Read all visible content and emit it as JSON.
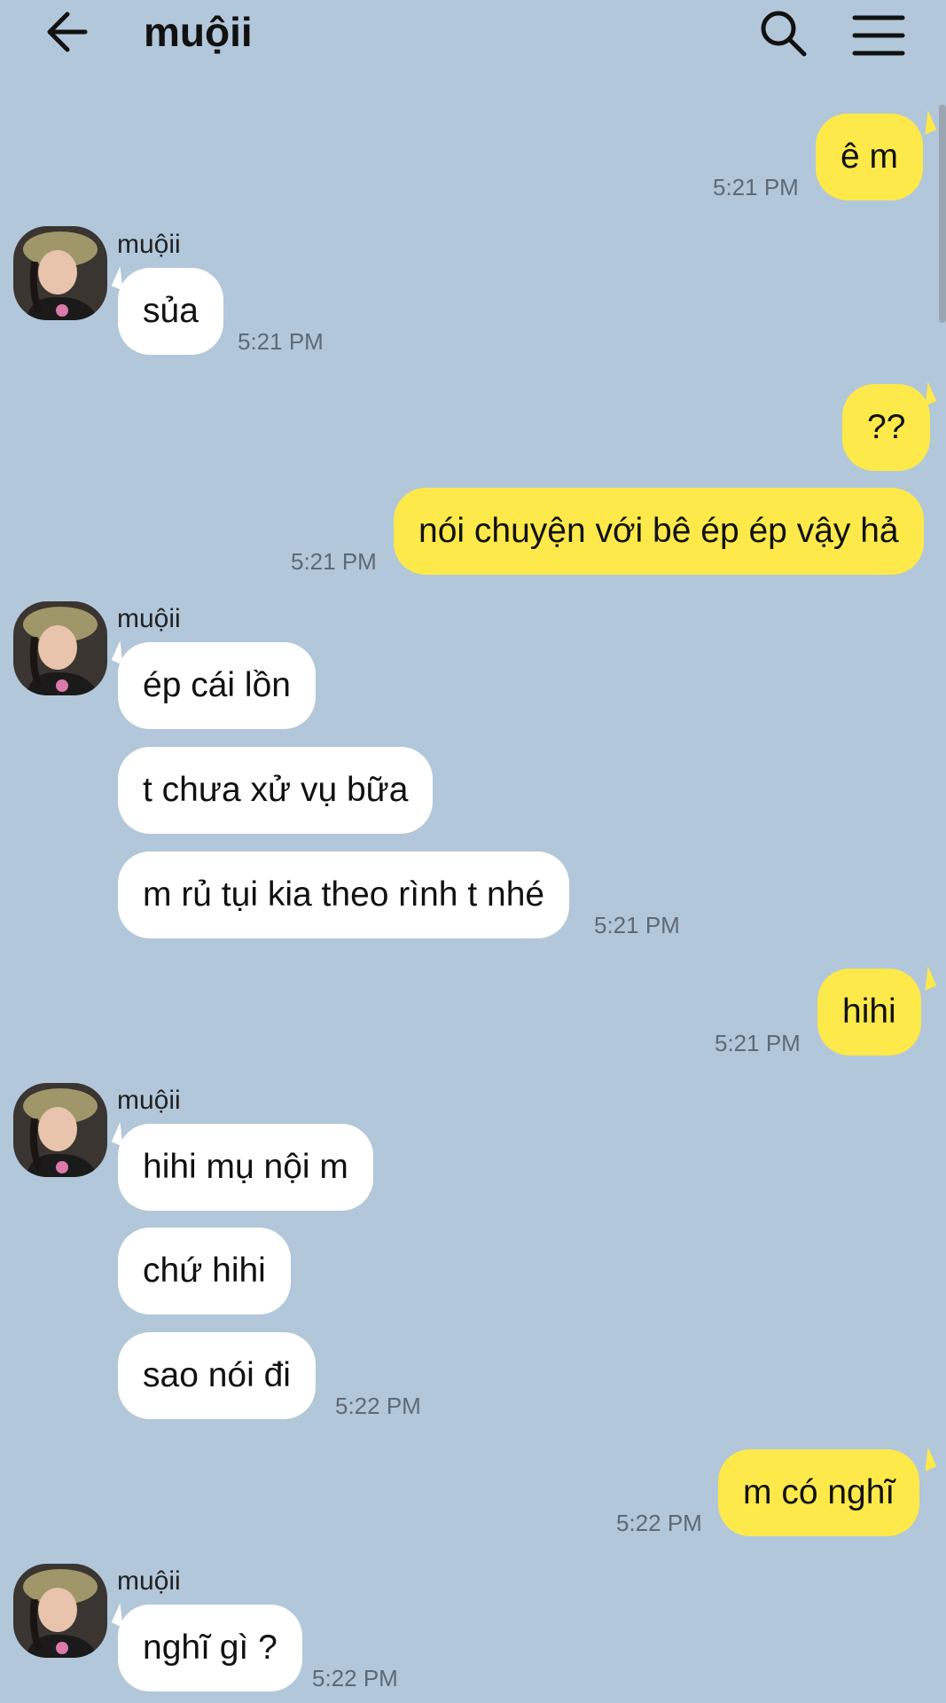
{
  "header": {
    "title": "muộii"
  },
  "messages": [
    {
      "from": "me",
      "text": "ê m",
      "time": "5:21 PM"
    },
    {
      "from": "them",
      "sender": "muộii",
      "text": "sủa",
      "time": "5:21 PM"
    },
    {
      "from": "me",
      "text": "??"
    },
    {
      "from": "me",
      "text": "nói chuyện với bê ép ép vậy hả",
      "time": "5:21 PM"
    },
    {
      "from": "them",
      "sender": "muộii",
      "text": "ép cái lồn"
    },
    {
      "from": "them",
      "text": "t chưa xử vụ bữa"
    },
    {
      "from": "them",
      "text": "m rủ tụi kia theo rình t nhé",
      "time": "5:21 PM"
    },
    {
      "from": "me",
      "text": "hihi",
      "time": "5:21 PM"
    },
    {
      "from": "them",
      "sender": "muộii",
      "text": "hihi mụ nội m"
    },
    {
      "from": "them",
      "text": "chứ hihi"
    },
    {
      "from": "them",
      "text": "sao nói đi",
      "time": "5:22 PM"
    },
    {
      "from": "me",
      "text": "m có nghĩ",
      "time": "5:22 PM"
    },
    {
      "from": "them",
      "sender": "muộii",
      "text": "nghĩ gì ?",
      "time": "5:22 PM"
    }
  ],
  "colors": {
    "background": "#b2c7da",
    "my_bubble": "#fde94a",
    "their_bubble": "#ffffff",
    "timestamp": "#5f6a75"
  },
  "icons": {
    "back": "arrow-left-icon",
    "search": "search-icon",
    "menu": "hamburger-menu-icon"
  }
}
